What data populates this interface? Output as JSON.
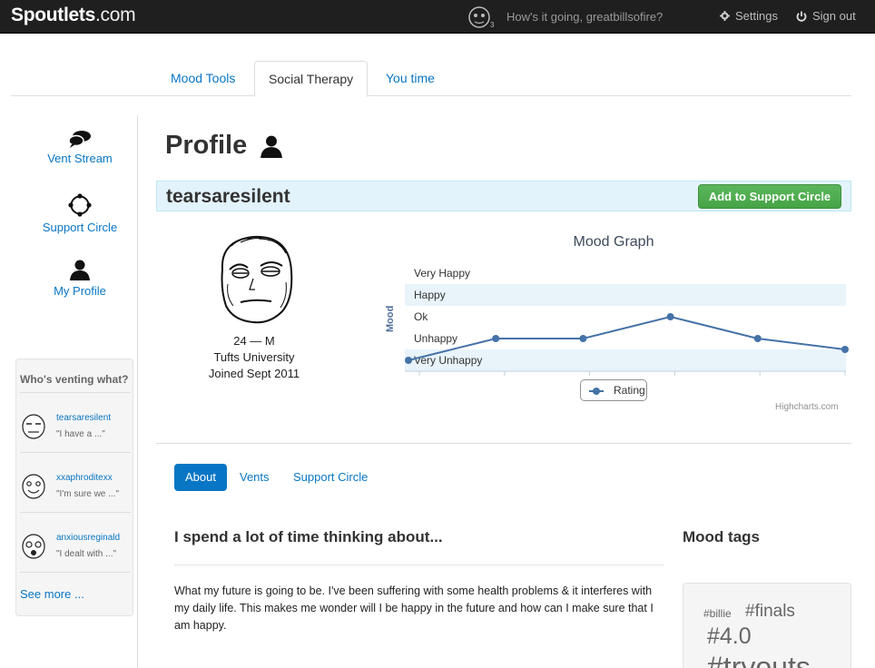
{
  "brand": {
    "name": "Spoutlets",
    "suffix": ".com"
  },
  "topbar": {
    "greeting": "How's it going, greatbillsofire?",
    "settings_label": "Settings",
    "signout_label": "Sign out"
  },
  "tabs": [
    {
      "label": "Mood Tools",
      "active": false
    },
    {
      "label": "Social Therapy",
      "active": true
    },
    {
      "label": "You time",
      "active": false
    }
  ],
  "sidebar": {
    "items": [
      {
        "label": "Vent Stream",
        "icon": "speech-bubbles-icon"
      },
      {
        "label": "Support Circle",
        "icon": "circle-icon"
      },
      {
        "label": "My Profile",
        "icon": "person-icon"
      }
    ]
  },
  "venting": {
    "title": "Who's venting what?",
    "entries": [
      {
        "user": "tearsaresilent",
        "snippet": "\"I have a ...\""
      },
      {
        "user": "xxaphroditexx",
        "snippet": "\"I'm sure we ...\""
      },
      {
        "user": "anxiousreginald",
        "snippet": "\"I dealt with ...\""
      }
    ],
    "see_more": "See more ..."
  },
  "profile": {
    "title": "Profile",
    "username": "tearsaresilent",
    "add_button": "Add to Support Circle",
    "age_sex": "24 — M",
    "school": "Tufts University",
    "joined": "Joined Sept 2011"
  },
  "chart_data": {
    "type": "line",
    "title": "Mood Graph",
    "ylabel": "Mood",
    "categories": [
      "Very Unhappy",
      "Unhappy",
      "Ok",
      "Happy",
      "Very Happy"
    ],
    "series": [
      {
        "name": "Rating",
        "values": [
          1.0,
          2.0,
          2.0,
          3.0,
          2.0,
          1.5
        ]
      }
    ],
    "credit": "Highcharts.com",
    "legend_position": "bottom-center",
    "color": "#4572a7"
  },
  "profile_tabs": [
    {
      "label": "About",
      "active": true
    },
    {
      "label": "Vents",
      "active": false
    },
    {
      "label": "Support Circle",
      "active": false
    }
  ],
  "about": {
    "heading": "I spend a lot of time thinking about...",
    "body": "What my future is going to be. I've been suffering with some health problems & it interferes with my daily life. This makes me wonder will I be happy in the future and how can I make sure that I am happy."
  },
  "mood_tags": {
    "heading": "Mood tags",
    "tags": [
      "#billie",
      "#finals",
      "#4.0",
      "#tryouts"
    ]
  }
}
